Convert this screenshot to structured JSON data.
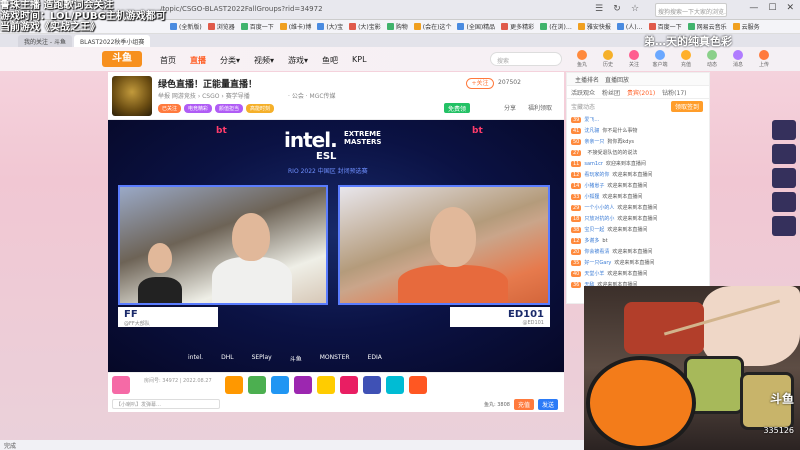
{
  "overlay": {
    "lines": [
      "鲁珠主播 造跑歌词会关注",
      "游戏时间：LOL/PUBG主机游戏都可",
      "当前游戏《实战之王》"
    ],
    "right_tag": "弟…天的纯真色彩"
  },
  "browser": {
    "url": "/topic/CSGO-BLAST2022FallGroups?rid=34972",
    "search_placeholder": "搜狗搜索一下大家的浏览…",
    "tools": [
      "☰",
      "↻",
      "☆"
    ],
    "window_controls": [
      "—",
      "☐",
      "✕"
    ]
  },
  "bookmarks": [
    "(全新版)",
    "浏览器",
    "百度一下",
    "(维卡)博",
    "(大)宝",
    "(大)宝影",
    "购物",
    "(会在)这个",
    "(全国)精品",
    "更多精彩",
    "(在浏)…",
    "雅安快报",
    "(人)…",
    "百度一下",
    "网易云音乐",
    "云服务"
  ],
  "tabs": [
    {
      "label": "我的关注 - 斗鱼",
      "active": false
    },
    {
      "label": "BLAST2022秋季小组赛",
      "active": true
    }
  ],
  "site": {
    "logo": "斗鱼",
    "nav": [
      "首页",
      "直播",
      "分类▾",
      "视频▾",
      "游戏▾",
      "鱼吧",
      "KPL"
    ],
    "active_nav": "直播",
    "search_placeholder": "搜索",
    "header_icons": [
      "鱼丸",
      "历史",
      "关注",
      "客户端",
      "充值",
      "动态",
      "消息",
      "上传"
    ]
  },
  "room": {
    "title": "绿色直播！正能量直播！",
    "meta": "举报  网游竞技 › CSGO › 赛学导播",
    "meta2": "· 公会 · MGC传媒",
    "tags": [
      "已关注",
      "电竞精彩",
      "颜值担当",
      "高能时刻"
    ],
    "follow": "+关注",
    "follow_count": "207502",
    "free_label": "免费领",
    "actions": [
      "分享",
      "福利领取"
    ]
  },
  "video": {
    "brand_left": "bt",
    "brand_right": "bt",
    "intel": "intel.",
    "extreme": "EXTREME\nMASTERS",
    "esl": "ESL",
    "subtitle": "RIO 2022 中国区 封闭预选赛",
    "caster_left": "FF",
    "caster_left_sub": "@FF大部队",
    "caster_right": "ED101",
    "caster_right_sub": "@ED101",
    "sponsors": [
      "intel.",
      "DHL",
      "SEPlay",
      "斗鱼",
      "MONSTER",
      "EDIA"
    ]
  },
  "controls": {
    "room_id_label": "房间号: 34972 | 2022.08.27",
    "chat_placeholder": "【小喇叭】发弹幕…",
    "gift_colors": [
      "#f56aa6",
      "#ff9800",
      "#4caf50",
      "#2196f3",
      "#9c27b0",
      "#ffcc00",
      "#e91e63",
      "#3f51b5",
      "#00bcd4",
      "#ff5722"
    ],
    "right_info": "鱼丸: 3808",
    "charge": "充值",
    "send": "发送"
  },
  "chat": {
    "top": [
      "主播排名",
      "直播回放"
    ],
    "tabs": [
      "活跃观众",
      "粉丝团",
      "贵宾(201)",
      "钻粉(17)"
    ],
    "active_tab": "贵宾(201)",
    "note": "宝藏动态",
    "gold_btn": "领取签到",
    "items": [
      {
        "lv": "39",
        "name": "爱飞…",
        "msg": ""
      },
      {
        "lv": "41",
        "name": "沈凡骊",
        "msg": "你不是什么事物"
      },
      {
        "lv": "50",
        "name": "亲亲一只",
        "msg": "狗你再kdys"
      },
      {
        "lv": "27",
        "name": "",
        "msg": "不接受退队伍的的说法"
      },
      {
        "lv": "11",
        "name": "sam1cr",
        "msg": "欢迎来到本直播间"
      },
      {
        "lv": "12",
        "name": "看玩家的你",
        "msg": "欢迎来到本直播间"
      },
      {
        "lv": "14",
        "name": "小猪崽子",
        "msg": "欢迎来到本直播间"
      },
      {
        "lv": "33",
        "name": "小狐狸",
        "msg": "欢迎来到本直播间"
      },
      {
        "lv": "29",
        "name": "一个小小的人",
        "msg": "欢迎来到本直播间"
      },
      {
        "lv": "18",
        "name": "只放对抗的小",
        "msg": "欢迎来到本直播间"
      },
      {
        "lv": "38",
        "name": "宝贝一起",
        "msg": "欢迎来到本直播间"
      },
      {
        "lv": "12",
        "name": "多谢多",
        "msg": "bt"
      },
      {
        "lv": "20",
        "name": "你会被看清",
        "msg": "欢迎来到本直播间"
      },
      {
        "lv": "35",
        "name": "好一只Gary",
        "msg": "欢迎来到本直播间"
      },
      {
        "lv": "40",
        "name": "天堂小羊",
        "msg": "欢迎来到本直播间"
      },
      {
        "lv": "36",
        "name": "无敌",
        "msg": "欢迎来到本直播间"
      }
    ]
  },
  "webcam": {
    "logo": "斗鱼",
    "number": "335126"
  },
  "status": "完成"
}
